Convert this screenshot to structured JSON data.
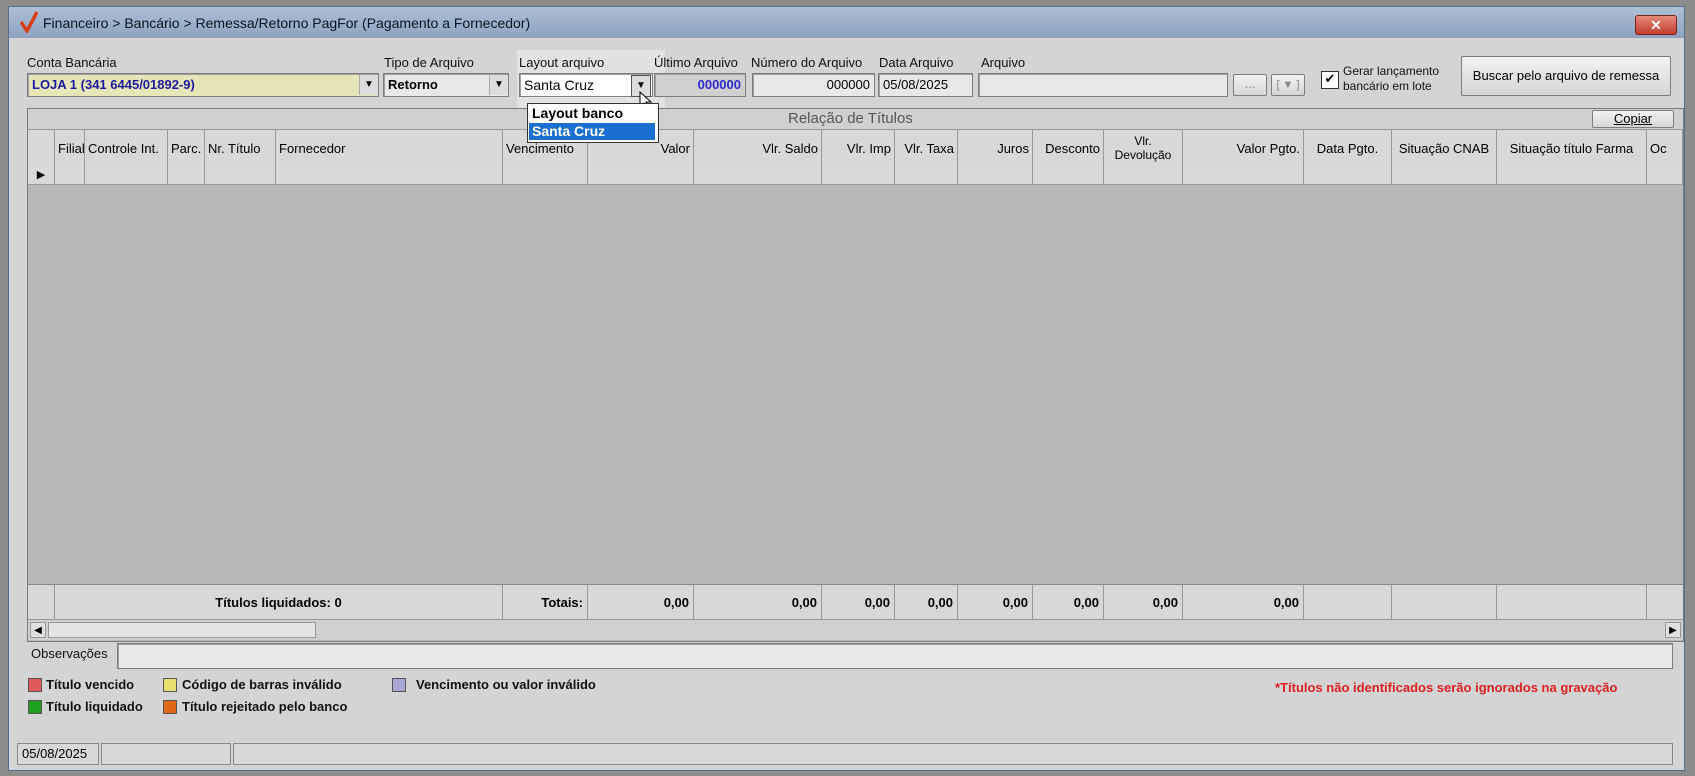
{
  "window": {
    "title": "Financeiro > Bancário > Remessa/Retorno PagFor (Pagamento  a Fornecedor)",
    "close_label": "✕"
  },
  "form": {
    "conta_bancaria": {
      "label": "Conta Bancária",
      "value": "LOJA 1 (341 6445/01892-9)"
    },
    "tipo_arquivo": {
      "label": "Tipo de Arquivo",
      "value": "Retorno"
    },
    "layout_arquivo": {
      "label": "Layout arquivo",
      "value": "Santa Cruz",
      "options": [
        "Layout banco",
        "Santa Cruz"
      ],
      "selected_index": 1
    },
    "ultimo_arquivo": {
      "label": "Último Arquivo",
      "value": "000000"
    },
    "numero_arquivo": {
      "label": "Número do Arquivo",
      "value": "000000"
    },
    "data_arquivo": {
      "label": "Data Arquivo",
      "value": "05/08/2025"
    },
    "arquivo": {
      "label": "Arquivo",
      "value": "",
      "browse_label": "...",
      "extra_label": "[ ▼ ]"
    },
    "gerar_lancamento": {
      "label_line1": "Gerar lançamento",
      "label_line2": "bancário em lote",
      "checked": true
    },
    "buscar_button": "Buscar pelo arquivo de remessa"
  },
  "grid": {
    "caption": "Relação de Títulos",
    "copy_button": "Copiar",
    "columns": [
      "Filial",
      "Controle Int.",
      "Parc.",
      "Nr. Título",
      "Fornecedor",
      "Vencimento",
      "Valor",
      "Vlr. Saldo",
      "Vlr. Imp",
      "Vlr. Taxa",
      "Juros",
      "Desconto",
      "Vlr. Devolução",
      "Valor Pgto.",
      "Data Pgto.",
      "Situação CNAB",
      "Situação título Farma",
      "Oc"
    ],
    "totals": {
      "liquidados": "Títulos liquidados: 0",
      "totais_label": "Totais:",
      "valor": "0,00",
      "saldo": "0,00",
      "imp": "0,00",
      "taxa": "0,00",
      "juros": "0,00",
      "desconto": "0,00",
      "devolucao": "0,00",
      "pgto": "0,00"
    }
  },
  "observacoes": {
    "label": "Observações",
    "value": ""
  },
  "legend": {
    "items": [
      {
        "label": "Título vencido",
        "color": "#e05a5a"
      },
      {
        "label": "Código de barras inválido",
        "color": "#e8e070"
      },
      {
        "label": "Vencimento ou valor inválido",
        "color": "#a8a8d8"
      },
      {
        "label": "Título liquidado",
        "color": "#1ea01e"
      },
      {
        "label": "Título rejeitado pelo banco",
        "color": "#e06818"
      }
    ],
    "warning": "*Títulos não identificados serão ignorados na gravação",
    "warning_color": "#e02020"
  },
  "statusbar": {
    "date": "05/08/2025"
  },
  "icons": {
    "app": "checkmark-logo-icon",
    "close": "close-icon",
    "dropdown": "chevron-down-icon",
    "row_pointer": "row-pointer-icon",
    "scroll_left": "arrow-left-icon",
    "scroll_right": "arrow-right-icon"
  }
}
